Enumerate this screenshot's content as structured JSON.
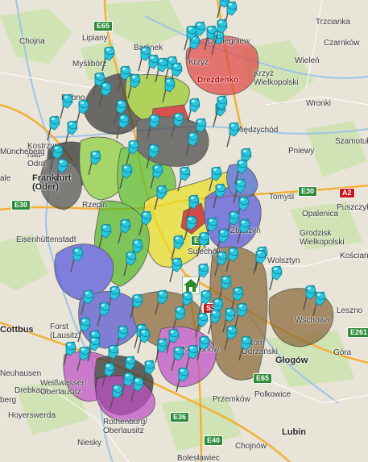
{
  "map": {
    "colors": {
      "land": "#e8e4d8",
      "forest": "#cfe3b4",
      "highway": "#f2b036",
      "water": "#9fc3e7",
      "pin": "#29c6e0"
    },
    "places": [
      {
        "id": "dobiegniew",
        "name": "Dobiegniew",
        "cls": ""
      },
      {
        "id": "trzcianka",
        "name": "Trzcianka",
        "cls": ""
      },
      {
        "id": "chojna",
        "name": "Chojna",
        "cls": ""
      },
      {
        "id": "lipiany",
        "name": "Lipiany",
        "cls": ""
      },
      {
        "id": "barlinek",
        "name": "Barlinek",
        "cls": ""
      },
      {
        "id": "krzyz",
        "name": "Krzyż",
        "cls": ""
      },
      {
        "id": "czarnkow",
        "name": "Czarnków",
        "cls": ""
      },
      {
        "id": "wielen",
        "name": "Wieleń",
        "cls": ""
      },
      {
        "id": "drezdenko",
        "name": "Drezdenko",
        "cls": "red"
      },
      {
        "id": "krzyz_wlkp",
        "name": "Krzyż Wielkopolski",
        "cls": ""
      },
      {
        "id": "mysliborz",
        "name": "Myślibórz",
        "cls": ""
      },
      {
        "id": "debno",
        "name": "Dębno",
        "cls": ""
      },
      {
        "id": "wronki",
        "name": "Wronki",
        "cls": ""
      },
      {
        "id": "miedzychod",
        "name": "Międzychód",
        "cls": ""
      },
      {
        "id": "samotuly",
        "name": "Szamotuły",
        "cls": ""
      },
      {
        "id": "kostrzyn",
        "name": "Kostrzyn nad Odrą",
        "cls": ""
      },
      {
        "id": "muncheberg",
        "name": "Müncheberg",
        "cls": ""
      },
      {
        "id": "pniewy",
        "name": "Pniewy",
        "cls": ""
      },
      {
        "id": "frankfurt",
        "name": "Frankfurt (Oder)",
        "cls": "big"
      },
      {
        "id": "rzepin",
        "name": "Rzepin",
        "cls": ""
      },
      {
        "id": "tomysl",
        "name": "Tomyśl",
        "cls": ""
      },
      {
        "id": "opalenica",
        "name": "Opalenica",
        "cls": ""
      },
      {
        "id": "eisenhuttenstadt",
        "name": "Eisenhüttenstadt",
        "cls": ""
      },
      {
        "id": "grodzisk",
        "name": "Grodzisk Wielkopolski",
        "cls": ""
      },
      {
        "id": "puszczyk",
        "name": "Puszczyk",
        "cls": ""
      },
      {
        "id": "koscian",
        "name": "Kościan",
        "cls": ""
      },
      {
        "id": "wolsztyn",
        "name": "Wolsztyn",
        "cls": ""
      },
      {
        "id": "sulechow",
        "name": "Sulechów",
        "cls": ""
      },
      {
        "id": "cottbus",
        "name": "Cottbus",
        "cls": "big"
      },
      {
        "id": "forst",
        "name": "Forst (Lausitz)",
        "cls": ""
      },
      {
        "id": "leszno",
        "name": "Leszno",
        "cls": ""
      },
      {
        "id": "neuhausen",
        "name": "Neuhausen",
        "cls": ""
      },
      {
        "id": "drebkau",
        "name": "Drebkau",
        "cls": ""
      },
      {
        "id": "glogow",
        "name": "Głogów",
        "cls": "big"
      },
      {
        "id": "gora",
        "name": "Góra",
        "cls": ""
      },
      {
        "id": "weisswasser",
        "name": "Weißwasser/ Oberlausitz",
        "cls": ""
      },
      {
        "id": "berg",
        "name": "berg",
        "cls": ""
      },
      {
        "id": "polkowice",
        "name": "Polkowice",
        "cls": ""
      },
      {
        "id": "przemkow",
        "name": "Przemków",
        "cls": ""
      },
      {
        "id": "hoyerswerda",
        "name": "Hoyerswerda",
        "cls": ""
      },
      {
        "id": "niesky",
        "name": "Niesky",
        "cls": ""
      },
      {
        "id": "rothenburg",
        "name": "Rothenburg/ Oberlausitz",
        "cls": ""
      },
      {
        "id": "lubin",
        "name": "Lubin",
        "cls": "big"
      },
      {
        "id": "chojnow",
        "name": "Chojnów",
        "cls": ""
      },
      {
        "id": "boleslawiec",
        "name": "Bolesławiec",
        "cls": ""
      },
      {
        "id": "ale",
        "name": "ale",
        "cls": ""
      },
      {
        "id": "wschowa",
        "name": "Wschowa",
        "cls": ""
      },
      {
        "id": "bytom",
        "name": "Bytom Odrzański",
        "cls": ""
      },
      {
        "id": "kozuchow",
        "name": "Kożuchów",
        "cls": ""
      },
      {
        "id": "zbaszyn",
        "name": "Zbąszyń",
        "cls": ""
      }
    ],
    "roads": [
      {
        "id": "e65n",
        "ref": "E65",
        "cls": ""
      },
      {
        "id": "e30e",
        "ref": "E30",
        "cls": ""
      },
      {
        "id": "a2",
        "ref": "A2",
        "cls": "red"
      },
      {
        "id": "e30w",
        "ref": "E30",
        "cls": ""
      },
      {
        "id": "e65m",
        "ref": "E65",
        "cls": ""
      },
      {
        "id": "e261",
        "ref": "E261",
        "cls": ""
      },
      {
        "id": "e36",
        "ref": "E36",
        "cls": ""
      },
      {
        "id": "e40",
        "ref": "E40",
        "cls": ""
      },
      {
        "id": "e65s",
        "ref": "E65",
        "cls": ""
      },
      {
        "id": "s3",
        "ref": "S3",
        "cls": "red"
      }
    ],
    "regions": [
      {
        "id": "drezdenko",
        "color": "#e04848"
      },
      {
        "id": "north-dark",
        "color": "#3a3a3a"
      },
      {
        "id": "north-green",
        "color": "#9ccc2a"
      },
      {
        "id": "north-red",
        "color": "#d01818"
      },
      {
        "id": "kostrzyn",
        "color": "#303030"
      },
      {
        "id": "slubice",
        "color": "#555555"
      },
      {
        "id": "west-green",
        "color": "#8cd23c"
      },
      {
        "id": "central-green",
        "color": "#5cc02c"
      },
      {
        "id": "miedzyrzecz",
        "color": "#4a4a4a"
      },
      {
        "id": "yellow",
        "color": "#e8e028"
      },
      {
        "id": "red-center",
        "color": "#c81010"
      },
      {
        "id": "east-purple",
        "color": "#5858d8"
      },
      {
        "id": "zbaszyn-blue",
        "color": "#4a6ad0"
      },
      {
        "id": "krosno-green",
        "color": "#58b828"
      },
      {
        "id": "gubin-blue",
        "color": "#5858e0"
      },
      {
        "id": "zary-blue",
        "color": "#5858d0"
      },
      {
        "id": "brown-nowogrod",
        "color": "#8a6a3a"
      },
      {
        "id": "brown-east",
        "color": "#8a6a3a"
      },
      {
        "id": "wschowa-brown",
        "color": "#8a6a3a"
      },
      {
        "id": "zagan-purple",
        "color": "#c050c8"
      },
      {
        "id": "leknica-purple",
        "color": "#c050c8"
      },
      {
        "id": "dark-south",
        "color": "#303030"
      }
    ],
    "home_marker": {
      "icon": "house-icon",
      "color": "#2a8a2a"
    },
    "pin_count": 110
  }
}
